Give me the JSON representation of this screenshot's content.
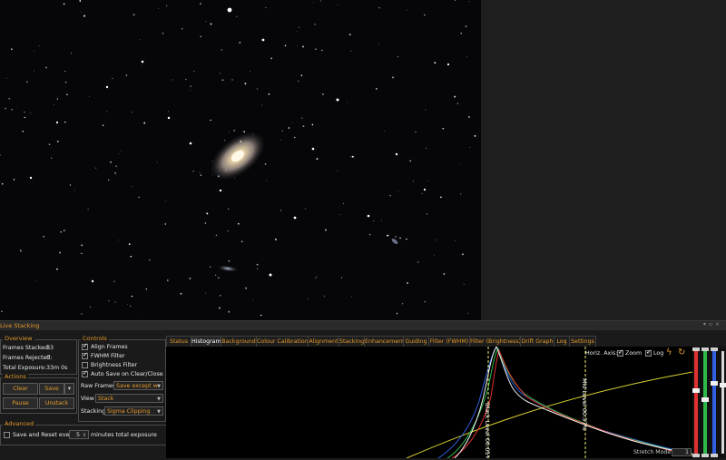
{
  "panel": {
    "title": "Live Stacking"
  },
  "overview": {
    "legend": "Overview",
    "frames_stacked_label": "Frames Stacked:",
    "frames_stacked": "33",
    "frames_rejected_label": "Frames Rejected:",
    "frames_rejected": "0",
    "total_exposure_label": "Total Exposure:",
    "total_exposure": "33m 0s"
  },
  "actions": {
    "legend": "Actions",
    "clear": "Clear",
    "save": "Save",
    "pause": "Pause",
    "unstack": "Unstack"
  },
  "advanced": {
    "legend": "Advanced",
    "save_reset_label": "Save and Reset every",
    "save_reset_checked": false,
    "minutes_value": "5",
    "minutes_suffix": "minutes total exposure"
  },
  "controls": {
    "legend": "Controls",
    "align_frames": {
      "label": "Align Frames",
      "checked": true
    },
    "fwhm_filter": {
      "label": "FWHM Filter",
      "checked": true
    },
    "brightness_filter": {
      "label": "Brightness Filter",
      "checked": false
    },
    "auto_save": {
      "label": "Auto Save on Clear/Close",
      "checked": true
    },
    "raw_frames_label": "Raw Frames",
    "raw_frames_value": "Save except w",
    "view_label": "View",
    "view_value": "Stack",
    "stacking_label": "Stacking",
    "stacking_value": "Sigma Clipping"
  },
  "tabs": [
    "Status",
    "Histogram",
    "Background",
    "Colour Calibration",
    "Alignment",
    "Stacking",
    "Enhancement",
    "Guiding",
    "Filter (FWHM)",
    "Filter (Brightness)",
    "Drift Graph",
    "Log",
    "Settings"
  ],
  "active_tab": "Histogram",
  "histogram": {
    "horiz_axis_label": "Horiz. Axis:",
    "zoom_label": "Zoom",
    "zoom_checked": true,
    "log_label": "Log",
    "log_checked": true,
    "black_level_label": "Black Level 00.05%",
    "mid_level_label": "Mid Level 00.57%",
    "stretch_mode_label": "Stretch Mode",
    "stretch_mode_value": "1"
  },
  "colors": {
    "accent": "#e49a2c",
    "red_channel": "#e03030",
    "green_channel": "#2fb84a",
    "blue_channel": "#3060e0",
    "luminance": "#f2f2f2",
    "curve": "#d8d030"
  }
}
